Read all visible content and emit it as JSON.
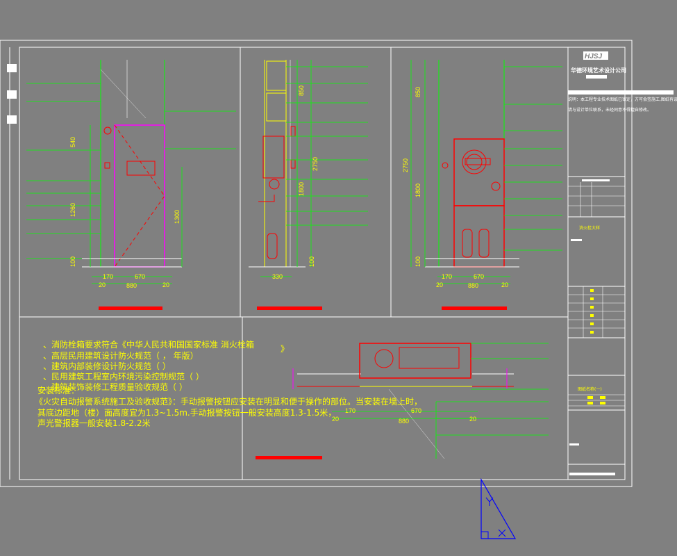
{
  "drawing": {
    "title_block": {
      "logo": "HJSJ",
      "company": "华德环境艺术设计公司",
      "note_line1": "说明：本工程专业技术图纸已审定，方可会签施工,图纸有误",
      "note_line2": "请与设计单位联系，未经同意不得擅自修改。",
      "project_label": "消火栓大样",
      "sheet_name": "图纸名称(一)"
    },
    "elevation_a": {
      "dims_vertical": [
        "540",
        "1260",
        "100",
        "1300"
      ],
      "dims_horizontal": [
        "170",
        "670",
        "880",
        "20",
        "20"
      ]
    },
    "section_b": {
      "dims_vertical": [
        "850",
        "2750",
        "1800",
        "100"
      ],
      "dims_horizontal": [
        "330"
      ]
    },
    "elevation_c": {
      "dims_vertical": [
        "850",
        "2750",
        "1800",
        "100"
      ],
      "dims_horizontal": [
        "170",
        "670",
        "880",
        "20",
        "20"
      ]
    },
    "plan_d": {
      "dims_horizontal": [
        "20",
        "170",
        "670",
        "880",
        "20"
      ]
    },
    "notes": {
      "line1": "、消防栓箱要求符合《中华人民共和国国家标准 消火栓箱",
      "line1_end": "》",
      "line2": "、高层民用建筑设计防火规范（          ，          年版）",
      "line3": "、建筑内部装修设计防火规范（               ）",
      "line4": "、民用建筑工程室内环境污染控制规范（               ）",
      "line5": "、建筑装饰装修工程质量验收规范（               ）",
      "line6": "安装标准：",
      "line7": "《火灾自动报警系统施工及验收规范》：手动报警按钮应安装在明显和便于操作的部位。当安装在墙上时，",
      "line8": "其底边距地（楼）面高度宜为1.3~1.5m.手动报警按钮一般安装高度1.3-1.5米，",
      "line9": "声光警报器一般安装1.8-2.2米"
    },
    "colors": {
      "background": "#808080",
      "line_white": "#ffffff",
      "line_green": "#00ff00",
      "line_red": "#ff0000",
      "line_magenta": "#ff00ff",
      "text_yellow": "#ffff00",
      "ucs_blue": "#0000ff"
    },
    "icons": [
      "ucs-icon",
      "fire-hose-reel-icon",
      "fire-extinguisher-icon",
      "alarm-bell-icon"
    ]
  }
}
